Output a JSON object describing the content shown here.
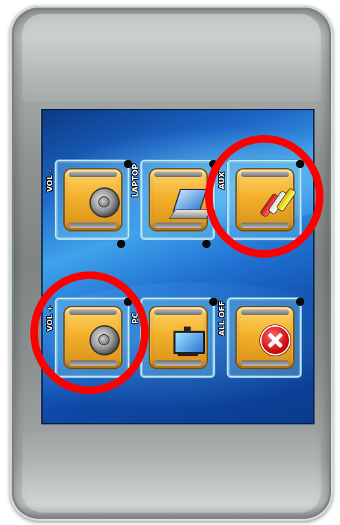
{
  "panel": {
    "buttons": [
      {
        "label": "VOL -",
        "icon": "speaker-icon"
      },
      {
        "label": "LAPTOP",
        "icon": "laptop-icon"
      },
      {
        "label": "AUX",
        "icon": "rca-plugs-icon"
      },
      {
        "label": "VOL +",
        "icon": "speaker-icon"
      },
      {
        "label": "PC",
        "icon": "monitor-icon"
      },
      {
        "label": "ALL OFF",
        "icon": "red-x-icon"
      }
    ]
  },
  "highlights": [
    {
      "target": "AUX",
      "color": "#ff0000"
    },
    {
      "target": "VOL +",
      "color": "#ff0000"
    }
  ],
  "colors": {
    "screen_blue": "#1c64c4",
    "button_gold": "#f3b12a",
    "highlight_red": "#ff0000"
  }
}
